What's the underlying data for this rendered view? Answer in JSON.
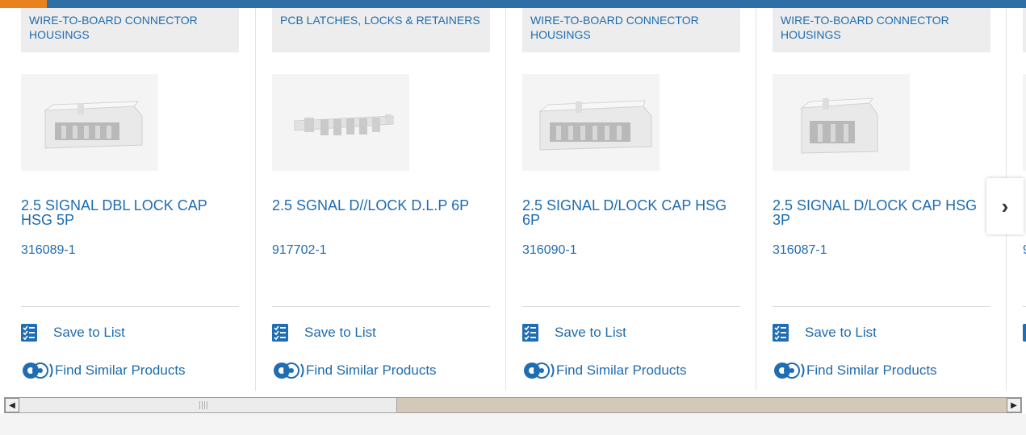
{
  "cards": [
    {
      "category": "WIRE-TO-BOARD CONNECTOR HOUSINGS",
      "title": "2.5 SIGNAL DBL LOCK CAP HSG 5P",
      "part_number": "316089-1",
      "save_label": "Save to List",
      "similar_label": "Find Similar Products",
      "image": "connector-housing-5p"
    },
    {
      "category": "PCB LATCHES, LOCKS & RETAINERS",
      "title": "2.5 SGNAL D//LOCK D.L.P 6P",
      "part_number": "917702-1",
      "save_label": "Save to List",
      "similar_label": "Find Similar Products",
      "image": "lock-strip-6p"
    },
    {
      "category": "WIRE-TO-BOARD CONNECTOR HOUSINGS",
      "title": "2.5 SIGNAL D/LOCK CAP HSG 6P",
      "part_number": "316090-1",
      "save_label": "Save to List",
      "similar_label": "Find Similar Products",
      "image": "connector-housing-6p"
    },
    {
      "category": "WIRE-TO-BOARD CONNECTOR HOUSINGS",
      "title": "2.5 SIGNAL D/LOCK CAP HSG 3P",
      "part_number": "316087-1",
      "save_label": "Save to List",
      "similar_label": "Find Similar Products",
      "image": "connector-housing-3p"
    }
  ],
  "partial_card_part_prefix": "9",
  "carousel": {
    "next_symbol": "›"
  },
  "scrollbar": {
    "left_symbol": "◀",
    "right_symbol": "▶"
  },
  "colors": {
    "accent": "#1e6cb0",
    "brand_bar": "#2f6fa6",
    "brand_accent": "#e8821c"
  }
}
